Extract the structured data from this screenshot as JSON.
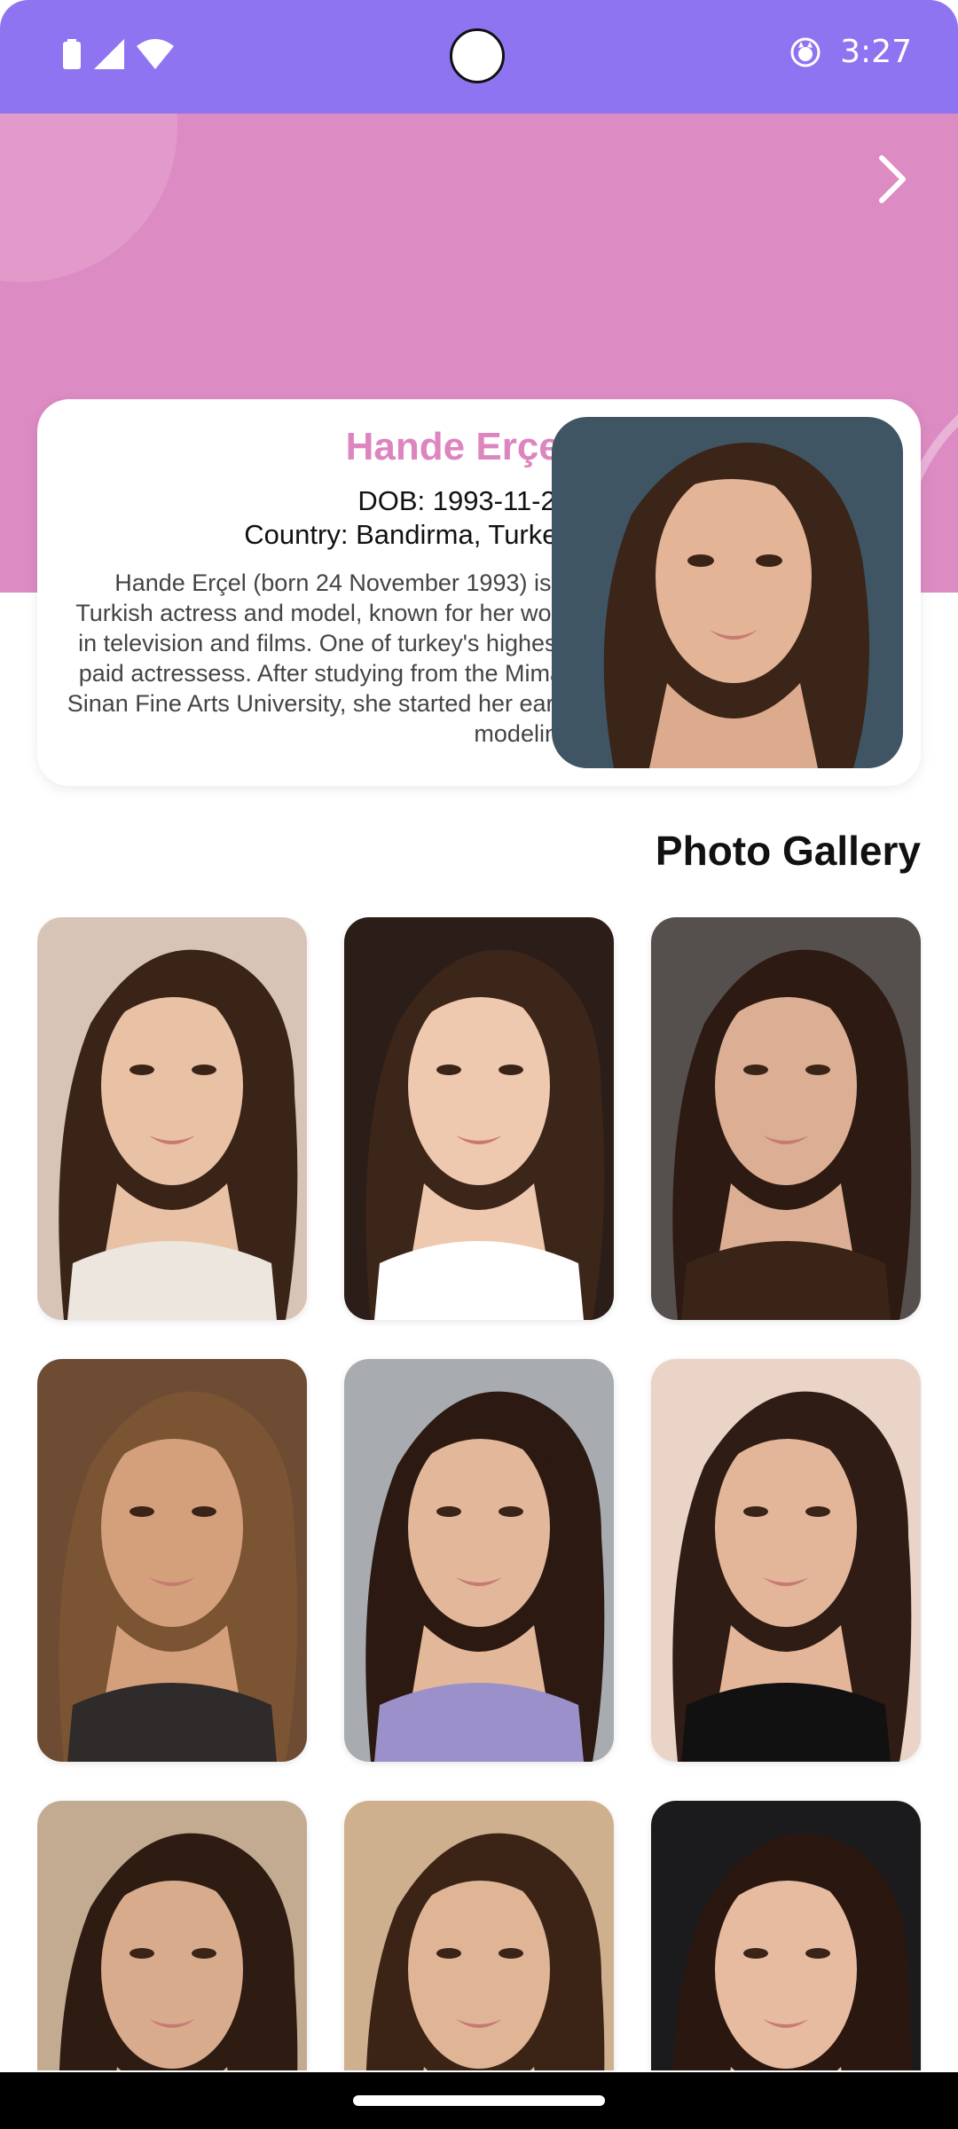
{
  "status_bar": {
    "time": "3:27",
    "icons": [
      "battery-icon",
      "signal-icon",
      "wifi-icon",
      "notification-app-icon"
    ]
  },
  "header": {
    "bg_color": "#dd8bc3",
    "next_icon": "chevron-right-icon"
  },
  "profile": {
    "name": "Hande Erçel",
    "dob": "DOB: 1993-11-24",
    "country": "Country: Bandirma, Turkey",
    "bio": "Hande Erçel (born 24 November 1993) is a Turkish actress and model, known for her work in television and films. One of turkey's highest-paid actressess. After studying from the Mimar Sinan Fine Arts University, she started her early modeling",
    "name_color": "#dd85bf"
  },
  "gallery": {
    "title": "Photo Gallery",
    "photos": [
      {
        "bg": "#d8c4b7",
        "hair": "#3a2418",
        "skin": "#e9c1a4",
        "top": "#ede6df"
      },
      {
        "bg": "#2b1d18",
        "hair": "#3c2519",
        "skin": "#efc8b0",
        "top": "#ffffff"
      },
      {
        "bg": "#55504d",
        "hair": "#2d1a12",
        "skin": "#dcae93",
        "top": "#3a2418"
      },
      {
        "bg": "#6e4b33",
        "hair": "#7a5433",
        "skin": "#d4a07c",
        "top": "#2f2b2b"
      },
      {
        "bg": "#a8acb1",
        "hair": "#2c1a12",
        "skin": "#e3b799",
        "top": "#9b90c9"
      },
      {
        "bg": "#ead3c7",
        "hair": "#2f1c14",
        "skin": "#e4b699",
        "top": "#111111"
      },
      {
        "bg": "#c3ab92",
        "hair": "#2e1b12",
        "skin": "#d9ab8d",
        "top": "#121212"
      },
      {
        "bg": "#cfb08e",
        "hair": "#3b2416",
        "skin": "#e0b596",
        "top": "#151515"
      },
      {
        "bg": "#1b1b1d",
        "hair": "#2a1710",
        "skin": "#e7bba0",
        "top": "#c99a85"
      }
    ]
  }
}
